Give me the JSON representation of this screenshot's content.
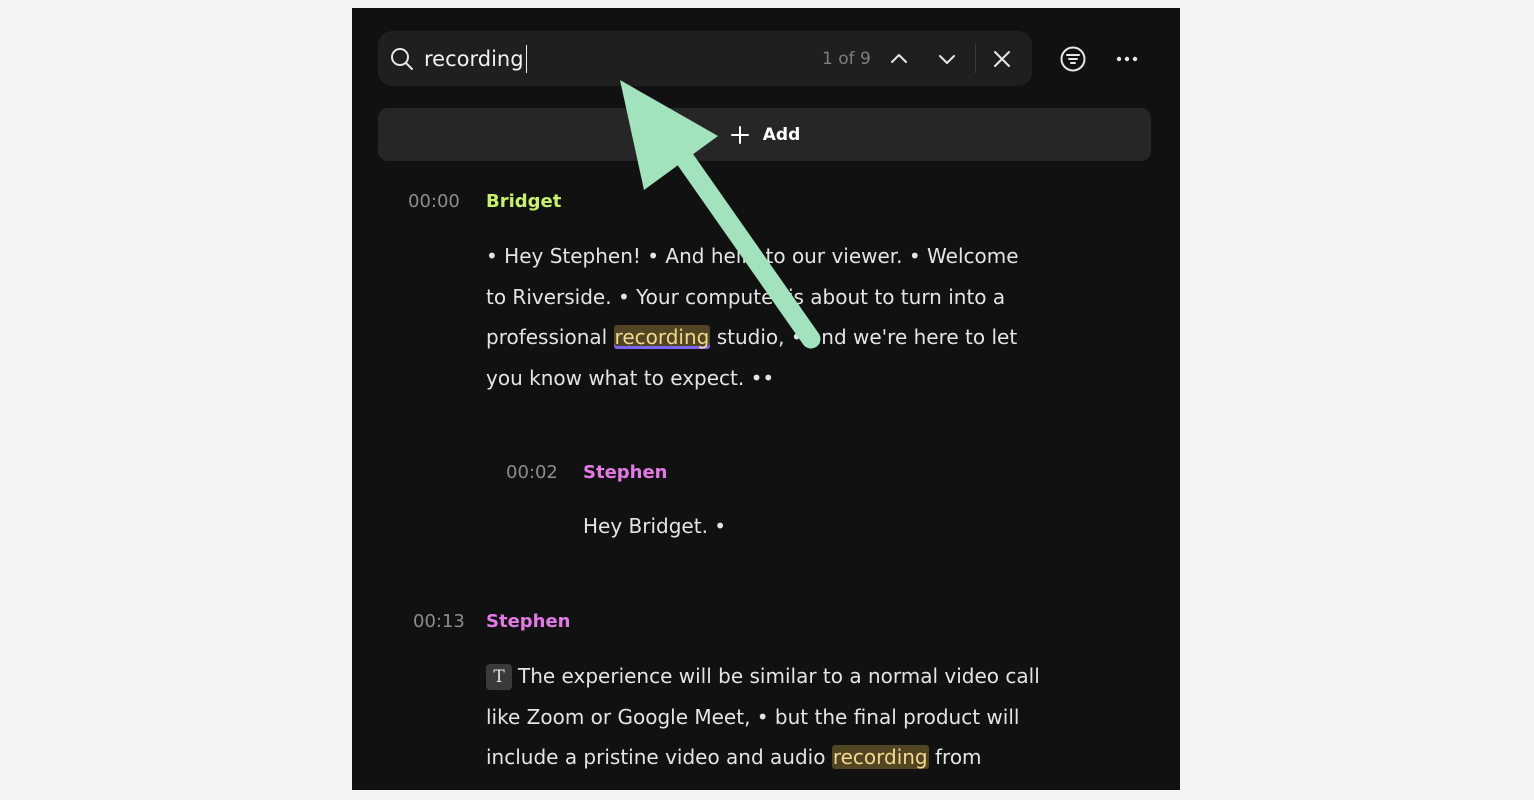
{
  "search": {
    "query": "recording",
    "match_count": "1 of 9"
  },
  "add_button": {
    "label": "Add"
  },
  "icons": {
    "search": "search-icon",
    "prev": "chevron-up-icon",
    "next": "chevron-down-icon",
    "close": "close-icon",
    "filter": "filter-icon",
    "more": "more-horizontal-icon",
    "add": "plus-icon",
    "edit": "text-edit-icon"
  },
  "colors": {
    "speaker_bridget": "#c6f06d",
    "speaker_stephen": "#e47ae6",
    "highlight_bg": "#514523",
    "highlight_text": "#f2d98d",
    "current_match_underline": "#7b65f0",
    "annotation_arrow": "#a2e3bd"
  },
  "transcript": {
    "block1": {
      "timestamp": "00:00",
      "speaker": "Bridget",
      "line1": "• Hey Stephen! • And hello to our viewer. • Welcome",
      "line2": "to Riverside. • Your computer is about to turn into a",
      "line3_pre": "professional ",
      "line3_match": "recording",
      "line3_post": " studio, • and we're here to let",
      "line4": "you know what to expect. ••"
    },
    "block2": {
      "timestamp": "00:02",
      "speaker": "Stephen",
      "line1": "Hey Bridget. •"
    },
    "block3": {
      "timestamp": "00:13",
      "speaker": "Stephen",
      "tag": "T",
      "line1": "The experience will be similar to a normal video call",
      "line2": "like Zoom or Google Meet, • but the final product will",
      "line3_pre": "include a pristine video and audio ",
      "line3_match": "recording",
      "line3_post": " from"
    }
  }
}
